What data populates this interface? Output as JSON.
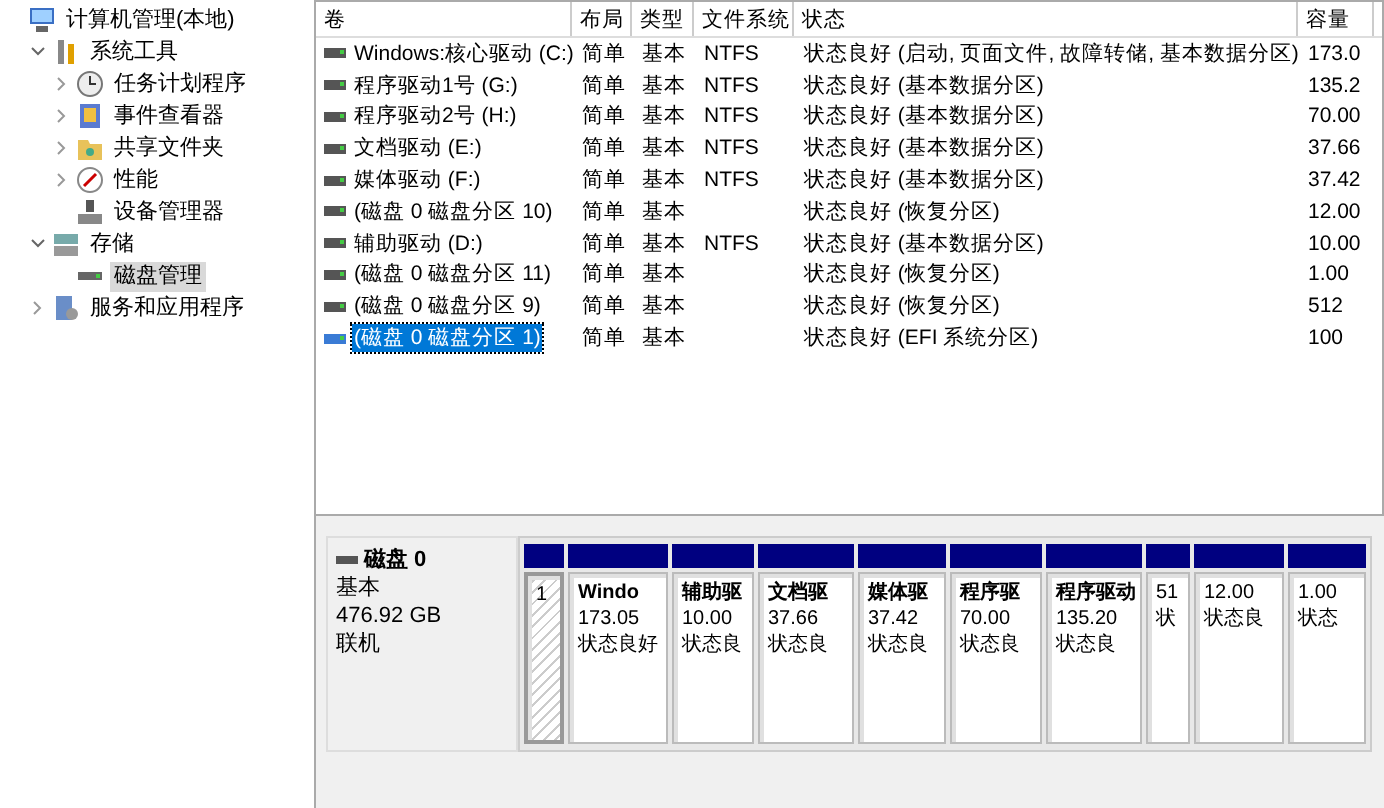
{
  "tree": [
    {
      "label": "计算机管理(本地)",
      "kind": "computer",
      "selected": false,
      "children": [
        {
          "label": "系统工具",
          "kind": "tools",
          "selected": false,
          "expanded": true,
          "children": [
            {
              "label": "任务计划程序",
              "kind": "clock",
              "selected": false,
              "expanded": false
            },
            {
              "label": "事件查看器",
              "kind": "event",
              "selected": false,
              "expanded": false
            },
            {
              "label": "共享文件夹",
              "kind": "folder",
              "selected": false,
              "expanded": false
            },
            {
              "label": "性能",
              "kind": "performance",
              "selected": false,
              "expanded": false
            },
            {
              "label": "设备管理器",
              "kind": "device",
              "selected": false
            }
          ]
        },
        {
          "label": "存储",
          "kind": "storage",
          "selected": false,
          "expanded": true,
          "children": [
            {
              "label": "磁盘管理",
              "kind": "disk",
              "selected": true
            }
          ]
        },
        {
          "label": "服务和应用程序",
          "kind": "services",
          "selected": false,
          "expanded": false
        }
      ]
    }
  ],
  "table": {
    "columns": [
      "卷",
      "布局",
      "类型",
      "文件系统",
      "状态",
      "容量"
    ],
    "rows": [
      {
        "cells": [
          "Windows:核心驱动 (C:)",
          "简单",
          "基本",
          "NTFS",
          "状态良好 (启动, 页面文件, 故障转储, 基本数据分区)",
          "173.0"
        ],
        "selected": false
      },
      {
        "cells": [
          "程序驱动1号 (G:)",
          "简单",
          "基本",
          "NTFS",
          "状态良好 (基本数据分区)",
          "135.2"
        ],
        "selected": false
      },
      {
        "cells": [
          "程序驱动2号 (H:)",
          "简单",
          "基本",
          "NTFS",
          "状态良好 (基本数据分区)",
          "70.00"
        ],
        "selected": false
      },
      {
        "cells": [
          "文档驱动 (E:)",
          "简单",
          "基本",
          "NTFS",
          "状态良好 (基本数据分区)",
          "37.66"
        ],
        "selected": false
      },
      {
        "cells": [
          "媒体驱动 (F:)",
          "简单",
          "基本",
          "NTFS",
          "状态良好 (基本数据分区)",
          "37.42"
        ],
        "selected": false
      },
      {
        "cells": [
          "(磁盘 0 磁盘分区 10)",
          "简单",
          "基本",
          "",
          "状态良好 (恢复分区)",
          "12.00"
        ],
        "selected": false
      },
      {
        "cells": [
          "辅助驱动 (D:)",
          "简单",
          "基本",
          "NTFS",
          "状态良好 (基本数据分区)",
          "10.00"
        ],
        "selected": false
      },
      {
        "cells": [
          "(磁盘 0 磁盘分区 11)",
          "简单",
          "基本",
          "",
          "状态良好 (恢复分区)",
          "1.00"
        ],
        "selected": false
      },
      {
        "cells": [
          "(磁盘 0 磁盘分区 9)",
          "简单",
          "基本",
          "",
          "状态良好 (恢复分区)",
          "512"
        ],
        "selected": false
      },
      {
        "cells": [
          "(磁盘 0 磁盘分区 1)",
          "简单",
          "基本",
          "",
          "状态良好 (EFI 系统分区)",
          "100"
        ],
        "selected": true
      }
    ]
  },
  "disk": {
    "name": "磁盘 0",
    "type": "基本",
    "size": "476.92 GB",
    "state": "联机",
    "partitions": [
      {
        "size": "1",
        "selected": true
      },
      {
        "name": "Windo",
        "size": "173.05",
        "status": "状态良好",
        "selected": false
      },
      {
        "name": "辅助驱",
        "size": "10.00",
        "status": "状态良",
        "selected": false
      },
      {
        "name": "文档驱",
        "size": "37.66",
        "status": "状态良",
        "selected": false
      },
      {
        "name": "媒体驱",
        "size": "37.42",
        "status": "状态良",
        "selected": false
      },
      {
        "name": "程序驱",
        "size": "70.00",
        "status": "状态良",
        "selected": false
      },
      {
        "name": "程序驱动",
        "size": "135.20",
        "status": "状态良",
        "selected": false
      },
      {
        "size": "51",
        "status": "状",
        "selected": false
      },
      {
        "size": "12.00",
        "status": "状态良",
        "selected": false
      },
      {
        "size": "1.00",
        "status": "状态",
        "selected": false
      }
    ]
  }
}
